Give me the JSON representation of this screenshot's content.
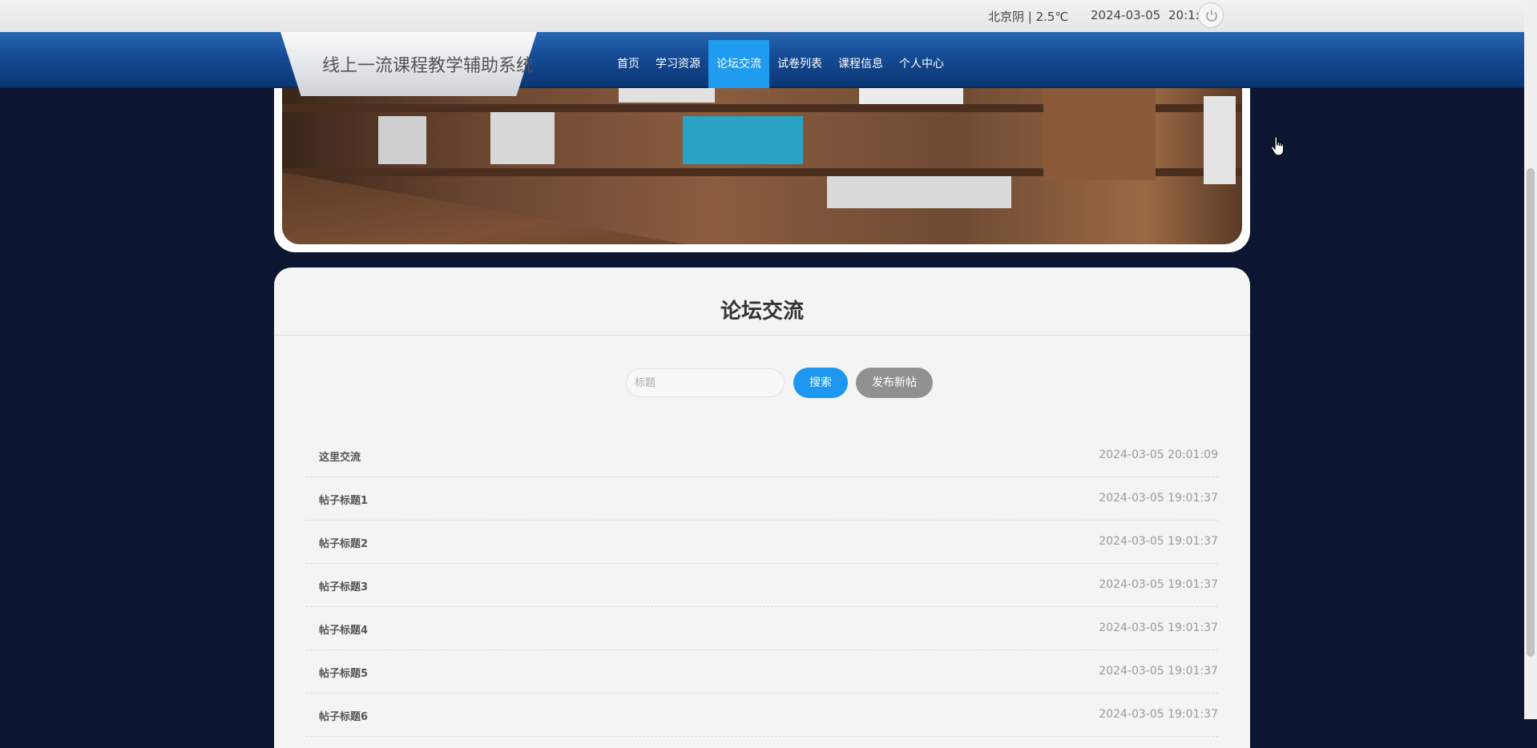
{
  "topbar": {
    "weather": "北京阴 | 2.5℃",
    "date": "2024-03-05",
    "time": "20:1:35",
    "power_icon": "power-icon"
  },
  "header": {
    "site_title": "线上一流课程教学辅助系统",
    "nav": [
      {
        "label": "首页",
        "active": false
      },
      {
        "label": "学习资源",
        "active": false
      },
      {
        "label": "论坛交流",
        "active": true
      },
      {
        "label": "试卷列表",
        "active": false
      },
      {
        "label": "课程信息",
        "active": false
      },
      {
        "label": "个人中心",
        "active": false
      }
    ]
  },
  "forum": {
    "title": "论坛交流",
    "search_placeholder": "标题",
    "search_button": "搜索",
    "new_post_button": "发布新帖",
    "posts": [
      {
        "title": "这里交流",
        "time": "2024-03-05 20:01:09"
      },
      {
        "title": "帖子标题1",
        "time": "2024-03-05 19:01:37"
      },
      {
        "title": "帖子标题2",
        "time": "2024-03-05 19:01:37"
      },
      {
        "title": "帖子标题3",
        "time": "2024-03-05 19:01:37"
      },
      {
        "title": "帖子标题4",
        "time": "2024-03-05 19:01:37"
      },
      {
        "title": "帖子标题5",
        "time": "2024-03-05 19:01:37"
      },
      {
        "title": "帖子标题6",
        "time": "2024-03-05 19:01:37"
      }
    ]
  },
  "colors": {
    "nav_active": "#1f9cf0",
    "search_button": "#1d97f0",
    "post_button": "#909090",
    "page_background": "#0c1630"
  }
}
